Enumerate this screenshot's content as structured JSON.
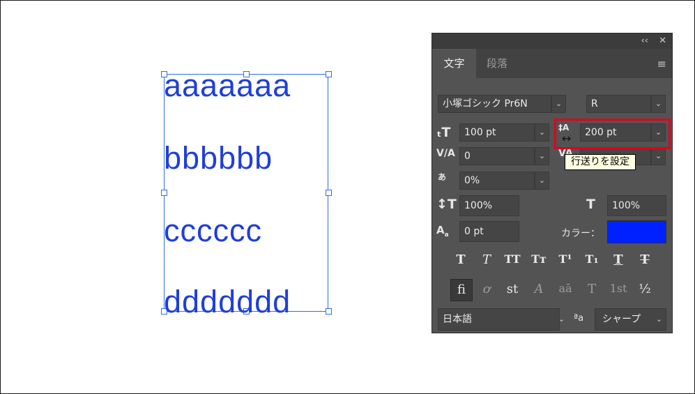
{
  "canvas": {
    "lines": [
      "aaaaaaa",
      "bbbbbb",
      "cccccc",
      "ddddddd"
    ],
    "text_color": "#1f3fd6",
    "frame_color": "#2f6cf0"
  },
  "panel": {
    "collapse_label": "‹‹",
    "close_label": "✕",
    "tabs": [
      {
        "label": "文字",
        "active": true
      },
      {
        "label": "段落",
        "active": false
      }
    ],
    "menu_icon": "hamburger-menu-icon",
    "font_family": "小塚ゴシック Pr6N",
    "font_style": "R",
    "font_size": "100 pt",
    "leading": "200 pt",
    "kerning": "0",
    "tracking": "0%",
    "vertical_scale": "100%",
    "horizontal_scale": "100%",
    "baseline_shift": "0 pt",
    "color_label": "カラー：",
    "color_value": "#0021ff",
    "language": "日本語",
    "antialias_icon_label": "ªa",
    "antialias": "シャープ",
    "leading_tooltip": "行送りを設定",
    "style_buttons": [
      "T",
      "T",
      "TT",
      "Tт",
      "T¹",
      "T₁",
      "T",
      "T"
    ],
    "opentype_buttons": [
      "fi",
      "ơ",
      "st",
      "A",
      "aā",
      "T",
      "1st",
      "½"
    ]
  }
}
